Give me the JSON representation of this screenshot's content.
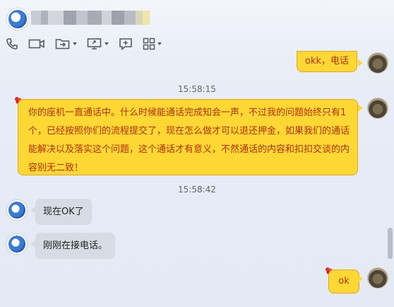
{
  "header": {
    "contact_name": ""
  },
  "toolbar": {
    "items": [
      {
        "icon": "phone-icon"
      },
      {
        "icon": "video-icon"
      },
      {
        "icon": "folder-transfer-icon"
      },
      {
        "icon": "screen-share-icon"
      },
      {
        "icon": "add-chat-icon"
      },
      {
        "icon": "apps-grid-icon"
      }
    ]
  },
  "messages": [
    {
      "side": "right",
      "text": "okk，电话"
    },
    {
      "timestamp": "15:58:15"
    },
    {
      "side": "right",
      "text_lines": [
        "你的座机一直通话中。什么时候能通话完成知会一声，不过我的问题始终只有1",
        "个，已经按照你们的流程提交了，现在怎么做才可以退还押金，如果我们的通话",
        "能解决以及落实这个问题，这个通话才有意义，不然通话的内容和扣扣交谈的内",
        "容别无二致！"
      ]
    },
    {
      "timestamp": "15:58:42"
    },
    {
      "side": "left",
      "text": "现在OK了"
    },
    {
      "side": "left",
      "text": "刚刚在接电话。"
    },
    {
      "side": "right",
      "text": "ok"
    }
  ],
  "colors": {
    "bubble_self": "#fdd835",
    "bubble_self_text": "#b7300c",
    "bubble_other": "#d7dbe3"
  }
}
